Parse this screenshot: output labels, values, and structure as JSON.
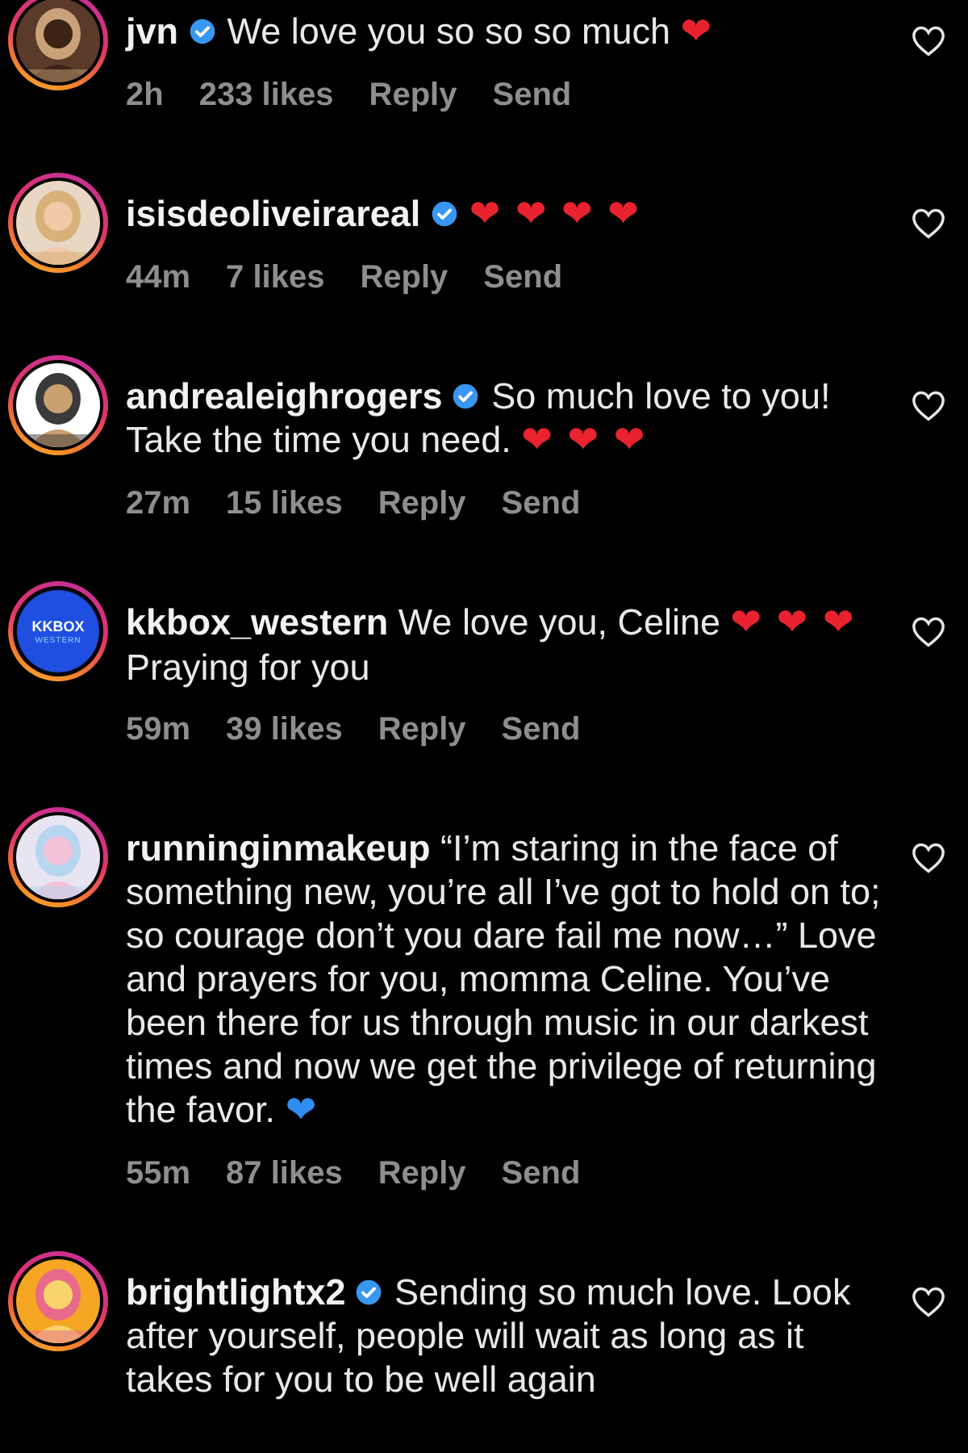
{
  "comments": [
    {
      "username": "jvn",
      "verified": true,
      "avatar": {
        "kind": "picture"
      },
      "body": [
        {
          "kind": "text",
          "text": "We love you so so so much "
        },
        {
          "kind": "emoji",
          "text": "❤",
          "color": "#e8232f"
        }
      ],
      "meta": {
        "time": "2h",
        "likes": "233 likes",
        "reply": "Reply",
        "send": "Send"
      }
    },
    {
      "username": "isisdeoliveirareal",
      "verified": true,
      "avatar": {
        "kind": "picture"
      },
      "body": [
        {
          "kind": "emoji",
          "text": "❤ ❤ ❤ ❤",
          "color": "#e8232f"
        }
      ],
      "meta": {
        "time": "44m",
        "likes": "7 likes",
        "reply": "Reply",
        "send": "Send"
      }
    },
    {
      "username": "andrealeighrogers",
      "verified": true,
      "avatar": {
        "kind": "picture"
      },
      "body": [
        {
          "kind": "text",
          "text": "So much love to you! Take the time you need. "
        },
        {
          "kind": "emoji",
          "text": "❤ ❤ ❤",
          "color": "#e8232f"
        }
      ],
      "meta": {
        "time": "27m",
        "likes": "15 likes",
        "reply": "Reply",
        "send": "Send"
      }
    },
    {
      "username": "kkbox_western",
      "verified": false,
      "avatar": {
        "kind": "logo",
        "title": "KKBOX",
        "subtitle": "WESTERN"
      },
      "body": [
        {
          "kind": "text",
          "text": "We love you, Celine "
        },
        {
          "kind": "emoji",
          "text": "❤ ❤ ❤",
          "color": "#e8232f"
        },
        {
          "kind": "text",
          "text": " Praying for you"
        }
      ],
      "meta": {
        "time": "59m",
        "likes": "39 likes",
        "reply": "Reply",
        "send": "Send"
      }
    },
    {
      "username": "runninginmakeup",
      "verified": false,
      "avatar": {
        "kind": "picture"
      },
      "body": [
        {
          "kind": "text",
          "text": "“I’m staring in the face of something new, you’re all I’ve got to hold on to; so courage don’t you dare fail me now…” Love and prayers for you, momma Celine. You’ve been there for us through music in our darkest times and now we get the privilege of returning the favor. "
        },
        {
          "kind": "emoji",
          "text": "❤",
          "color": "#2f8cf0"
        }
      ],
      "meta": {
        "time": "55m",
        "likes": "87 likes",
        "reply": "Reply",
        "send": "Send"
      }
    },
    {
      "username": "brightlightx2",
      "verified": true,
      "avatar": {
        "kind": "picture"
      },
      "body": [
        {
          "kind": "text",
          "text": "Sending so much love. Look after yourself, people will wait as long as it takes for you to be well again"
        }
      ]
    }
  ]
}
